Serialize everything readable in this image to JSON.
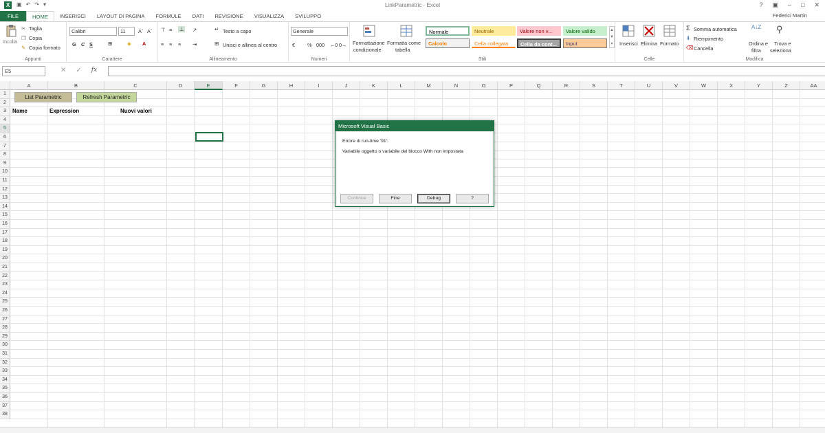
{
  "window": {
    "title": "LinkParametric - Excel",
    "user": "Federici Martin",
    "app_icon": "X"
  },
  "quick_access": [
    "save-icon",
    "undo-icon",
    "redo-icon",
    "customize-icon"
  ],
  "tabs": [
    {
      "label": "FILE"
    },
    {
      "label": "HOME"
    },
    {
      "label": "INSERISCI"
    },
    {
      "label": "LAYOUT DI PAGINA"
    },
    {
      "label": "FORMULE"
    },
    {
      "label": "DATI"
    },
    {
      "label": "REVISIONE"
    },
    {
      "label": "VISUALIZZA"
    },
    {
      "label": "SVILUPPO"
    }
  ],
  "ribbon": {
    "clipboard": {
      "paste": "Incolla",
      "cut": "Taglia",
      "copy": "Copia",
      "format_painter": "Copia formato",
      "group": "Appunti"
    },
    "font": {
      "name": "Calibri",
      "size": "11",
      "bold": "G",
      "italic": "C",
      "underline": "S",
      "group": "Carattere"
    },
    "alignment": {
      "wrap": "Testo a capo",
      "merge": "Unisci e allinea al centro",
      "group": "Allineamento"
    },
    "number": {
      "format": "Generale",
      "percent": "%",
      "thousands": "000",
      "group": "Numeri"
    },
    "styles": {
      "cond_format_1": "Formattazione",
      "cond_format_2": "condizionale",
      "format_table_1": "Formatta come",
      "format_table_2": "tabella",
      "normale": "Normale",
      "neutrale": "Neutrale",
      "valore_non": "Valore non v...",
      "valore_valido": "Valore valido",
      "calcolo": "Calcolo",
      "cella_collegata": "Cella collegata",
      "cella_da": "Cella da cont...",
      "input": "Input",
      "group": "Stili"
    },
    "cells": {
      "insert": "Inserisci",
      "delete": "Elimina",
      "format": "Formato",
      "group": "Celle"
    },
    "editing": {
      "autosum": "Somma automatica",
      "fill": "Riempimento",
      "clear": "Cancella",
      "sort_1": "Ordina e",
      "sort_2": "filtra",
      "find_1": "Trova e",
      "find_2": "seleziona",
      "group": "Modifica"
    }
  },
  "formula_bar": {
    "name_box": "E5",
    "fx": "fx",
    "formula": ""
  },
  "columns": [
    "A",
    "B",
    "C",
    "D",
    "E",
    "F",
    "G",
    "H",
    "I",
    "J",
    "K",
    "L",
    "M",
    "N",
    "O",
    "P",
    "Q",
    "R",
    "S",
    "T",
    "U",
    "V",
    "W",
    "X",
    "Y",
    "Z",
    "AA"
  ],
  "rows": [
    "1",
    "2",
    "3",
    "4",
    "5",
    "6",
    "7",
    "8",
    "9",
    "10",
    "11",
    "12",
    "13",
    "14",
    "15",
    "16",
    "17",
    "18",
    "19",
    "20",
    "21",
    "22",
    "23",
    "24",
    "25",
    "26",
    "27",
    "28",
    "29",
    "30",
    "31",
    "32",
    "33",
    "34",
    "35",
    "36",
    "37",
    "38"
  ],
  "sheet_cells": {
    "a2": "Name",
    "b2": "Expression",
    "c2": "Nuovi valori"
  },
  "shape_buttons": {
    "list": "List Parametric",
    "refresh": "Refresh Parametric"
  },
  "dialog": {
    "title": "Microsoft Visual Basic",
    "line1": "Errore di run-time '91':",
    "line2": "Variabile oggetto o variabile del blocco With non impostata",
    "buttons": {
      "continue": "Continue",
      "end": "Fine",
      "debug": "Debug",
      "help": "?"
    }
  },
  "colors": {
    "excel_green": "#217346",
    "normale_border": "#7fb89a",
    "neutrale_bg": "#ffeb9c",
    "bad_bg": "#ffc7ce",
    "good_bg": "#c6efce",
    "calcolo_bg": "#f2f2f2",
    "checkcell_bg": "#a5a5a5",
    "input_bg": "#ffcc99"
  }
}
